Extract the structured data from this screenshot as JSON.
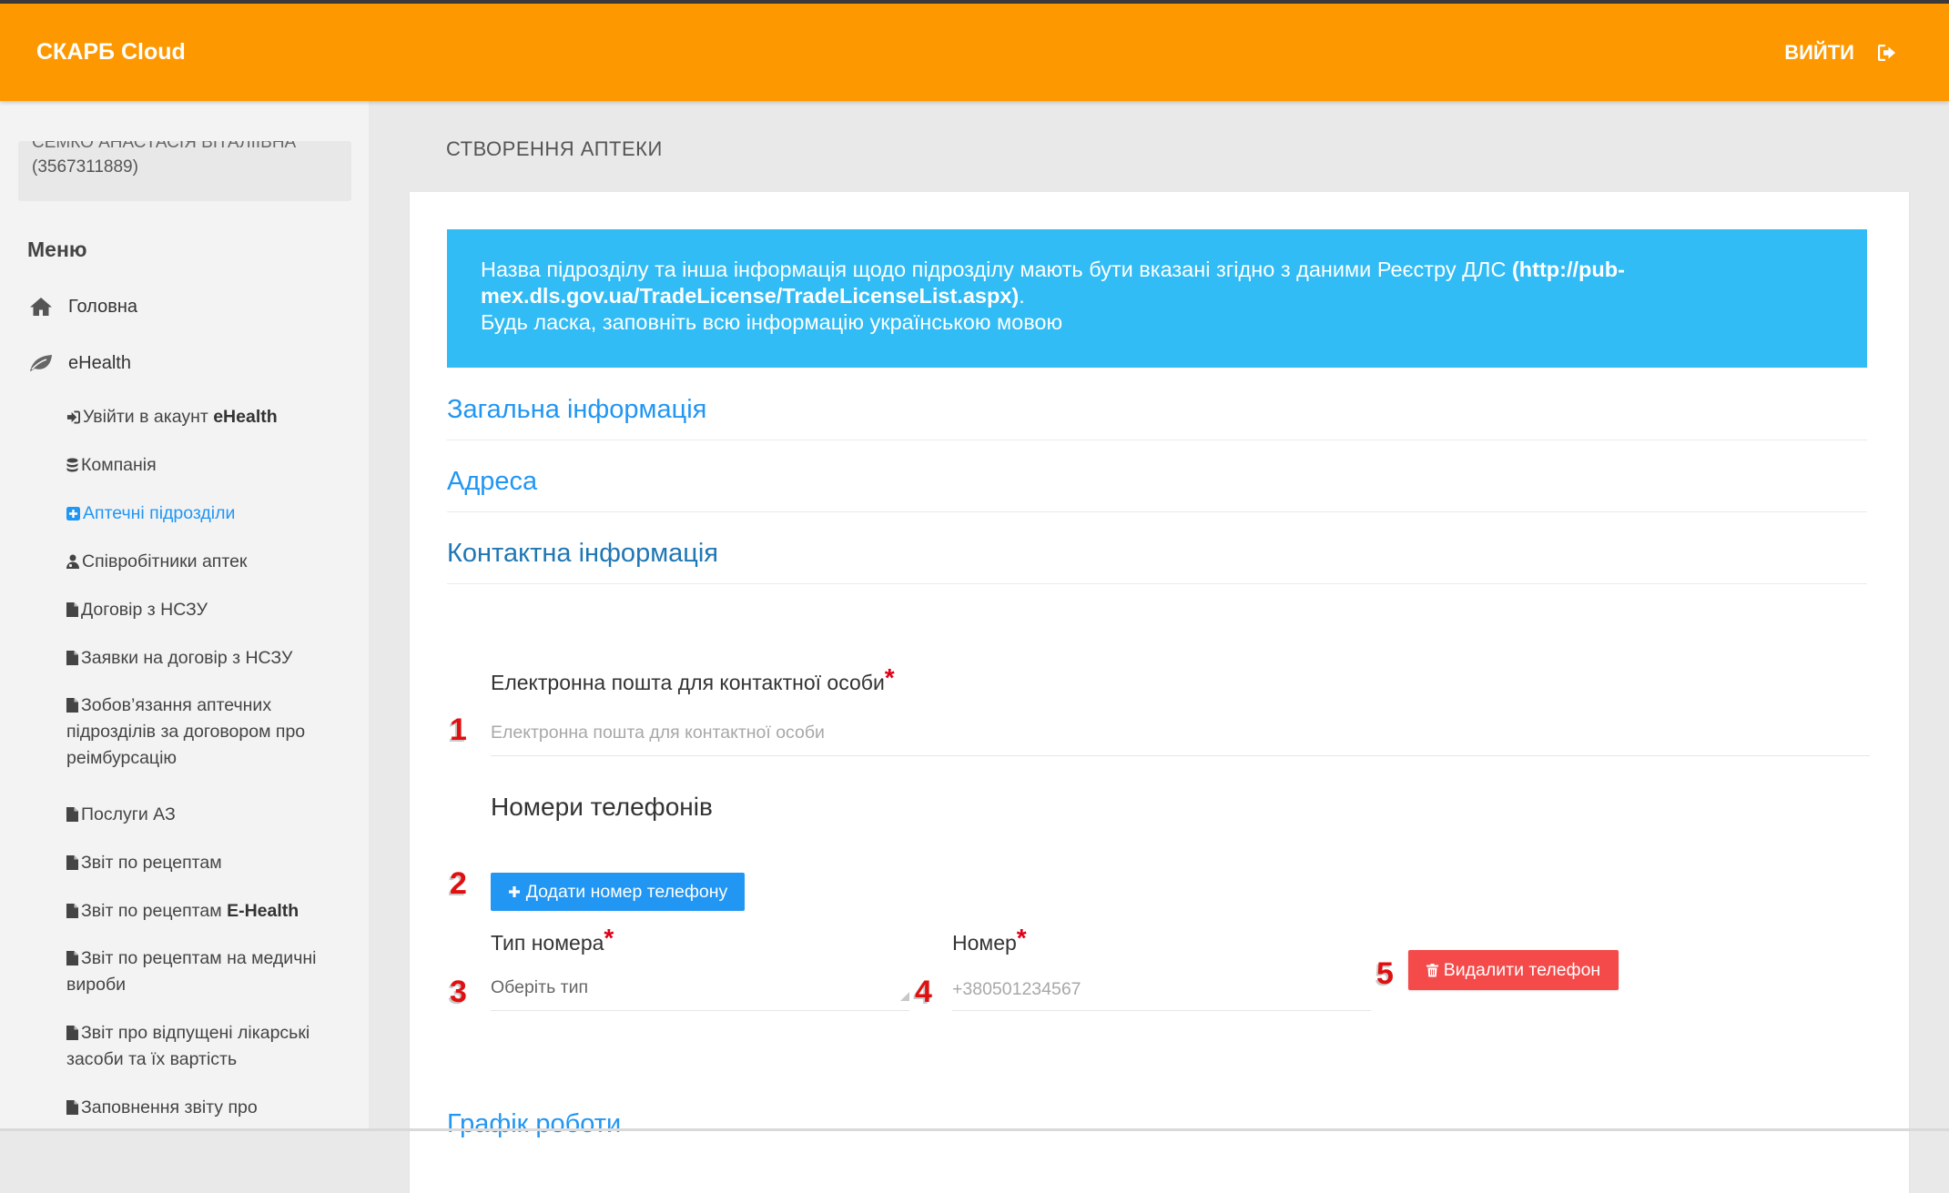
{
  "header": {
    "brand": "СКАРБ Cloud",
    "logout_label": "ВИЙТИ",
    "logout_icon": "sign-out-icon",
    "background_color": "#fe9800"
  },
  "sidebar": {
    "user_name": "СЕМКО АНАСТАСІЯ ВІТАЛІЇВНА",
    "user_id": "(3567311889)",
    "menu_title": "Меню",
    "top_items": [
      {
        "label": "Головна",
        "icon": "home-icon"
      },
      {
        "label": "eHealth",
        "icon": "leaf-icon"
      }
    ],
    "sub_items": [
      {
        "label": "Увійти в акаунт ",
        "bold": "eHealth",
        "icon": "sign-in-icon"
      },
      {
        "label": "Компанія",
        "icon": "database-icon"
      },
      {
        "label": "Аптечні підрозділи",
        "icon": "plus-square-icon",
        "active": true
      },
      {
        "label": "Співробітники аптек",
        "icon": "user-md-icon"
      },
      {
        "label": "Договір з НСЗУ",
        "icon": "file-icon"
      },
      {
        "label": "Заявки на договір з НСЗУ",
        "icon": "file-icon"
      },
      {
        "label": "Зобов’язання аптечних підрозділів за договором про реімбурсацію",
        "icon": "file-icon"
      },
      {
        "label": "Послуги АЗ",
        "icon": "file-icon"
      },
      {
        "label": "Звіт по рецептам",
        "icon": "file-icon"
      },
      {
        "label": "Звіт по рецептам ",
        "bold": "E-Health",
        "icon": "file-icon"
      },
      {
        "label": "Звіт по рецептам на медичні вироби",
        "icon": "file-icon"
      },
      {
        "label": "Звіт про відпущені лікарські засоби та їх вартість",
        "icon": "file-icon"
      },
      {
        "label": "Заповнення звіту про",
        "icon": "file-icon"
      }
    ],
    "active_color": "#2196f3"
  },
  "main": {
    "page_title": "СТВОРЕННЯ АПТЕКИ",
    "alert": {
      "line1": "Назва підрозділу та інша інформація щодо підрозділу мають бути вказані згідно з даними Реєстру ДЛС",
      "link": "(http://pub-mex.dls.gov.ua/TradeLicense/TradeLicenseList.aspx)",
      "line1_end": ".",
      "line2": "Будь ласка, заповніть всю інформацію українською мовою",
      "background_color": "#31bcf5"
    },
    "sections": [
      "Загальна інформація",
      "Адреса",
      "Контактна інформація"
    ],
    "email": {
      "label": "Електронна пошта для контактної особи",
      "required_mark": "*",
      "placeholder": "Електронна пошта для контактної особи",
      "value": ""
    },
    "phones_title": "Номери телефонів",
    "add_phone_button": "Додати номер телефону",
    "phone_type": {
      "label": "Тип номера",
      "required_mark": "*",
      "selected": "Оберіть тип"
    },
    "phone_number": {
      "label": "Номер",
      "required_mark": "*",
      "placeholder": "+380501234567",
      "value": ""
    },
    "delete_phone_button": "Видалити телефон",
    "next_section": "Графік роботи",
    "markers": [
      "1",
      "2",
      "3",
      "4",
      "5"
    ],
    "primary_color": "#2196f3",
    "danger_color": "#f44a4a",
    "marker_color": "#e01010"
  }
}
